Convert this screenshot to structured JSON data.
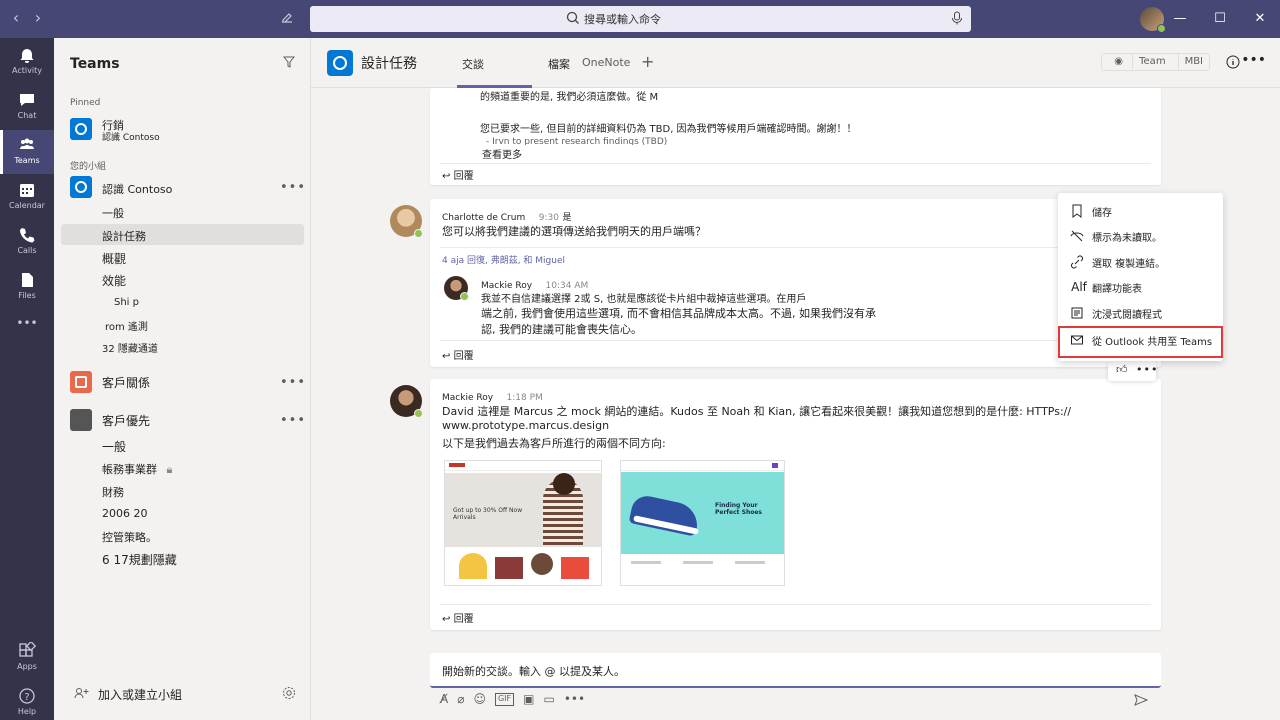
{
  "topbar": {
    "search_placeholder": "搜尋或輸入命令",
    "back": "‹",
    "forward": "›"
  },
  "rail": {
    "items": [
      {
        "label": "Activity",
        "icon": "bell-icon"
      },
      {
        "label": "Chat",
        "icon": "chat-icon"
      },
      {
        "label": "Teams",
        "icon": "teams-icon"
      },
      {
        "label": "Calendar",
        "icon": "calendar-icon"
      },
      {
        "label": "Calls",
        "icon": "phone-icon"
      },
      {
        "label": "Files",
        "icon": "file-icon"
      },
      {
        "label": "Apps",
        "icon": "apps-icon"
      },
      {
        "label": "Help",
        "icon": "help-icon"
      }
    ],
    "more": "•••"
  },
  "sidebar": {
    "title": "Teams",
    "pinned_label": "Pinned",
    "pinned": {
      "name": "行銷",
      "sub": "認識 Contoso"
    },
    "your_teams_label": "您的小組",
    "teams": [
      {
        "name": "認識 Contoso",
        "channels": [
          "一般",
          "設計任務",
          "概觀",
          "效能",
          "Shi p",
          "rom 遙測",
          "32 隱藏通道"
        ]
      },
      {
        "name": "客戶關係",
        "channels": []
      },
      {
        "name": "客戶優先",
        "channels": [
          "一般",
          "帳務事業群",
          "財務",
          "2006 20",
          "控管策略。",
          "6 17規劃隱藏"
        ]
      }
    ],
    "add_team": "加入或建立小組"
  },
  "channel": {
    "title": "設計任務",
    "tabs": [
      "交談",
      "檔案",
      "OneNote"
    ],
    "add_tab": "+",
    "team_label": "Team",
    "mbi_label": "MBI"
  },
  "messages": {
    "first": {
      "line1": "的頻道重要的是, 我們必須這麼做。從 M",
      "line2": "您已要求一些, 但目前的詳細資料仍為 TBD, 因為我們等候用戶端確認時間。謝謝！！",
      "line3": "- Irvn to present research findings (TBD)",
      "see_more": "查看更多",
      "reply": "回覆"
    },
    "second": {
      "author": "Charlotte de Crum",
      "time": "9:30",
      "time_suffix": "是",
      "body": "您可以將我們建議的選項傳送給我們明天的用戶端嗎？",
      "replies_summary": "4 aja 回復, 弗朗茲, 和  Miguel",
      "reply_author": "Mackie Roy",
      "reply_time": "10:34 AM",
      "reply_line1": "我並不自信建議選擇 2或 S, 也就是應該從卡片組中裁掉這些選項。在用戶",
      "reply_line2": "端之前, 我們會使用這些選項, 而不會相信其品牌成本太高。不過, 如果我們沒有承",
      "reply_line3": "認, 我們的建議可能會喪失信心。",
      "reply": "回覆"
    },
    "third": {
      "author": "Mackie Roy",
      "time": "1:18 PM",
      "line1": "David 這裡是 Marcus 之 mock 網站的連結。Kudos 至 Noah 和 Kian, 讓它看起來很美觀！讓我知道您想到的是什麼: HTTPs://",
      "link": "www.prototype.marcus.design",
      "line2": "以下是我們過去為客戶所進行的兩個不同方向:",
      "thumb1_title": "Got up to 30% Off Now Arrivals",
      "thumb2_title": "Finding Your Perfect Shoes",
      "reply": "回覆"
    }
  },
  "context_menu": {
    "items": [
      {
        "label": "儲存",
        "icon": "bookmark-icon"
      },
      {
        "label": "標示為未讀取。",
        "icon": "unread-icon"
      },
      {
        "label": "選取 複製連結。",
        "icon": "link-icon"
      },
      {
        "label": "翻譯功能表",
        "icon": "translate-icon"
      },
      {
        "label": "沈浸式閱讀程式",
        "icon": "reader-icon"
      },
      {
        "label": "從 Outlook 共用至 Teams",
        "icon": "mail-icon"
      }
    ]
  },
  "compose": {
    "placeholder": "開始新的交談。輸入 @ 以提及某人。"
  },
  "colors": {
    "brand": "#6264a7",
    "titlebar": "#464775",
    "rail": "#33344a",
    "highlight_border": "#e03a3a",
    "presence": "#92c353"
  }
}
